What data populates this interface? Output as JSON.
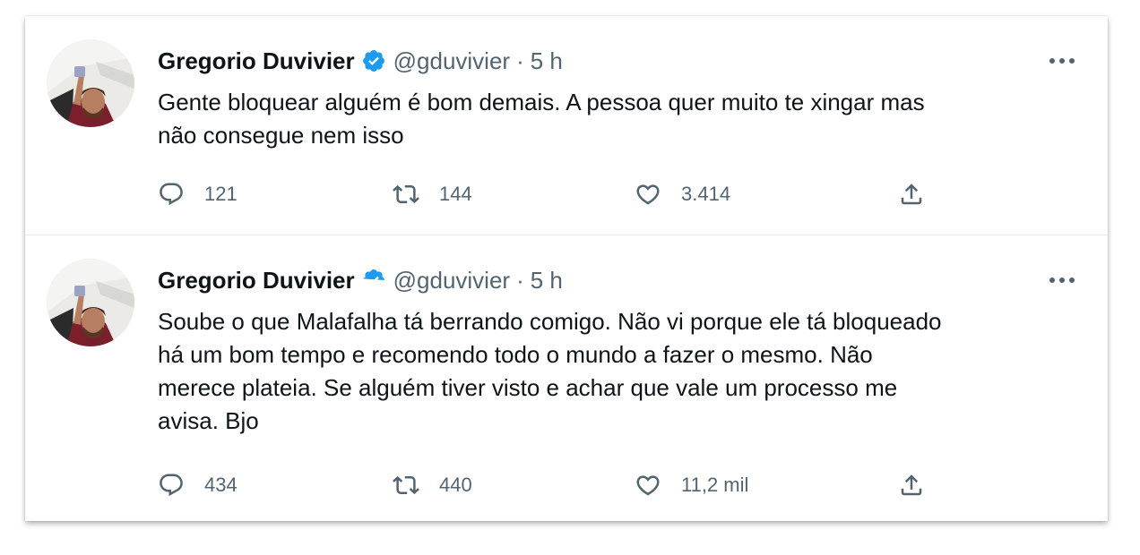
{
  "tweets": [
    {
      "author_name": "Gregorio Duvivier",
      "handle": "@gduvivier",
      "separator": "·",
      "time": "5 h",
      "text": "Gente bloquear alguém é bom demais. A pessoa quer muito te xingar mas\nnão consegue nem isso",
      "replies": "121",
      "retweets": "144",
      "likes": "3.414"
    },
    {
      "author_name": "Gregorio Duvivier",
      "handle": "@gduvivier",
      "separator": "·",
      "time": "5 h",
      "text": "Soube o que Malafalha tá berrando comigo. Não vi porque ele tá bloqueado\nhá um bom tempo e recomendo todo o mundo a fazer o mesmo. Não\nmerece plateia. Se alguém tiver visto e achar que vale um processo me\navisa. Bjo",
      "replies": "434",
      "retweets": "440",
      "likes": "11,2 mil"
    }
  ],
  "icons": {
    "verified": "verified-badge-icon",
    "more": "more-options-icon",
    "reply": "reply-icon",
    "retweet": "retweet-icon",
    "like": "like-icon",
    "share": "share-icon"
  },
  "colors": {
    "verified_blue": "#1d9bf0",
    "text": "#0f1419",
    "secondary": "#536471"
  }
}
